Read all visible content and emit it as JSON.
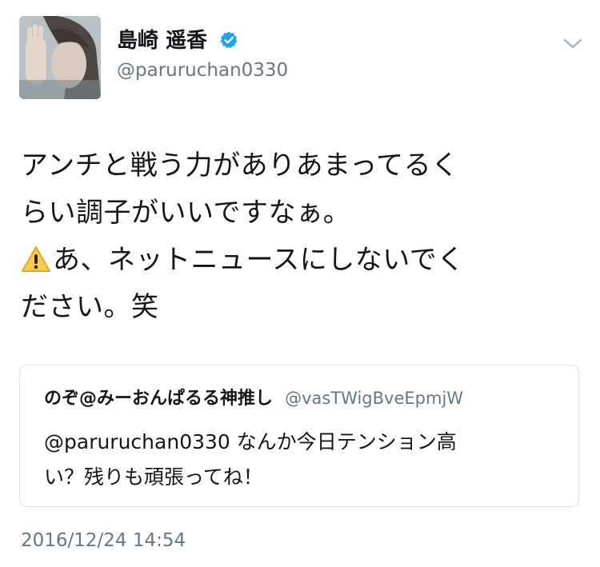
{
  "author": {
    "display_name": "島崎 遥香",
    "screen_name": "@paruruchan0330",
    "verified": true,
    "avatar_icon": "profile-photo"
  },
  "tweet": {
    "lines": [
      "アンチと戦う力がありあまってるく",
      "らい調子がいいですなぁ。",
      "あ、ネットニュースにしないでく",
      "ださい。笑"
    ],
    "emoji_icon": "warning-sign-icon"
  },
  "quoted_tweet": {
    "display_name": "のぞ@みーおんぱるる神推し",
    "screen_name": "@vasTWigBveEpmjW",
    "lines": [
      "@paruruchan0330 なんか今日テンション高",
      "い？残りも頑張ってね！"
    ]
  },
  "timestamp": "2016/12/24 14:54",
  "colors": {
    "text_primary": "#14171a",
    "text_secondary": "#657786",
    "verified_blue": "#1da1f2",
    "border": "#dfe3e6",
    "warning_yellow": "#ffcc4d"
  }
}
